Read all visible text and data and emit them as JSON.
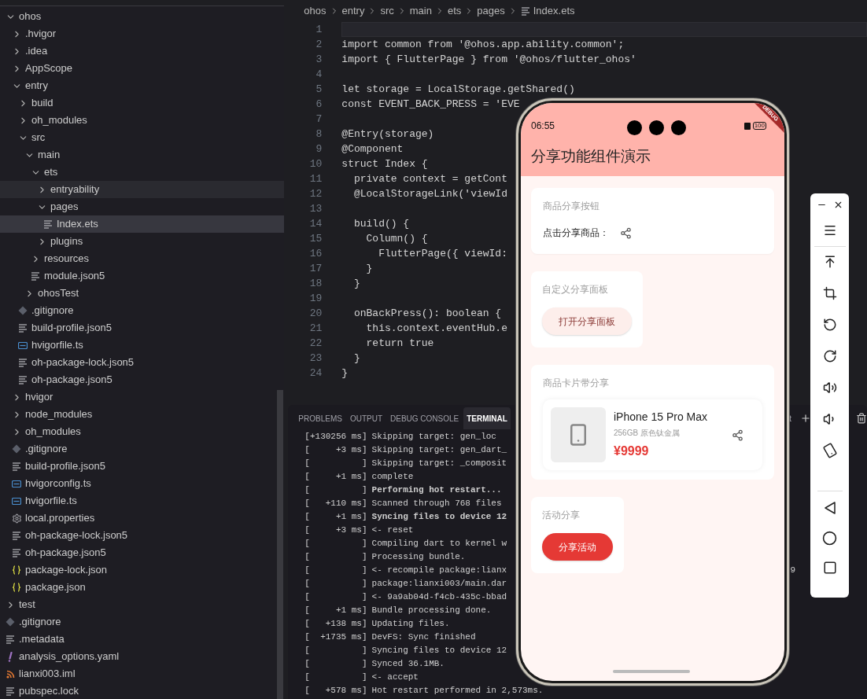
{
  "explorer": {
    "items": [
      {
        "name": "ohos",
        "kind": "folder",
        "expanded": true,
        "selected": false,
        "hovered": false,
        "children": [
          {
            "name": ".hvigor",
            "kind": "folder",
            "expanded": false,
            "selected": false,
            "hovered": false
          },
          {
            "name": ".idea",
            "kind": "folder",
            "expanded": false,
            "selected": false,
            "hovered": false
          },
          {
            "name": "AppScope",
            "kind": "folder",
            "expanded": false,
            "selected": false,
            "hovered": false
          },
          {
            "name": "entry",
            "kind": "folder",
            "expanded": true,
            "selected": false,
            "hovered": false,
            "children": [
              {
                "name": "build",
                "kind": "folder",
                "expanded": false,
                "selected": false,
                "hovered": false
              },
              {
                "name": "oh_modules",
                "kind": "folder",
                "expanded": false,
                "selected": false,
                "hovered": false
              },
              {
                "name": "src",
                "kind": "folder",
                "expanded": true,
                "selected": false,
                "hovered": false,
                "children": [
                  {
                    "name": "main",
                    "kind": "folder",
                    "expanded": true,
                    "selected": false,
                    "hovered": false,
                    "children": [
                      {
                        "name": "ets",
                        "kind": "folder",
                        "expanded": true,
                        "selected": false,
                        "hovered": false,
                        "children": [
                          {
                            "name": "entryability",
                            "kind": "folder",
                            "expanded": false,
                            "selected": false,
                            "hovered": true
                          },
                          {
                            "name": "pages",
                            "kind": "folder",
                            "expanded": true,
                            "selected": false,
                            "hovered": false,
                            "children": [
                              {
                                "name": "Index.ets",
                                "kind": "text",
                                "selected": true,
                                "hovered": false
                              }
                            ]
                          },
                          {
                            "name": "plugins",
                            "kind": "folder",
                            "expanded": false,
                            "selected": false,
                            "hovered": false
                          }
                        ]
                      },
                      {
                        "name": "resources",
                        "kind": "folder",
                        "expanded": false,
                        "selected": false,
                        "hovered": false
                      },
                      {
                        "name": "module.json5",
                        "kind": "text",
                        "selected": false,
                        "hovered": false
                      }
                    ]
                  },
                  {
                    "name": "ohosTest",
                    "kind": "folder",
                    "expanded": false,
                    "selected": false,
                    "hovered": false
                  }
                ]
              },
              {
                "name": ".gitignore",
                "kind": "git",
                "selected": false,
                "hovered": false
              },
              {
                "name": "build-profile.json5",
                "kind": "text",
                "selected": false,
                "hovered": false
              },
              {
                "name": "hvigorfile.ts",
                "kind": "ts",
                "selected": false,
                "hovered": false
              },
              {
                "name": "oh-package-lock.json5",
                "kind": "text",
                "selected": false,
                "hovered": false
              },
              {
                "name": "oh-package.json5",
                "kind": "text",
                "selected": false,
                "hovered": false
              }
            ]
          },
          {
            "name": "hvigor",
            "kind": "folder",
            "expanded": false,
            "selected": false,
            "hovered": false
          },
          {
            "name": "node_modules",
            "kind": "folder",
            "expanded": false,
            "selected": false,
            "hovered": false
          },
          {
            "name": "oh_modules",
            "kind": "folder",
            "expanded": false,
            "selected": false,
            "hovered": false
          },
          {
            "name": ".gitignore",
            "kind": "git",
            "selected": false,
            "hovered": false
          },
          {
            "name": "build-profile.json5",
            "kind": "text",
            "selected": false,
            "hovered": false
          },
          {
            "name": "hvigorconfig.ts",
            "kind": "ts",
            "selected": false,
            "hovered": false
          },
          {
            "name": "hvigorfile.ts",
            "kind": "ts",
            "selected": false,
            "hovered": false
          },
          {
            "name": "local.properties",
            "kind": "settings",
            "selected": false,
            "hovered": false
          },
          {
            "name": "oh-package-lock.json5",
            "kind": "text",
            "selected": false,
            "hovered": false
          },
          {
            "name": "oh-package.json5",
            "kind": "text",
            "selected": false,
            "hovered": false
          },
          {
            "name": "package-lock.json",
            "kind": "json",
            "selected": false,
            "hovered": false
          },
          {
            "name": "package.json",
            "kind": "json",
            "selected": false,
            "hovered": false
          }
        ]
      },
      {
        "name": "test",
        "kind": "folder",
        "expanded": false,
        "selected": false,
        "hovered": false
      },
      {
        "name": ".gitignore",
        "kind": "git",
        "selected": false,
        "hovered": false
      },
      {
        "name": ".metadata",
        "kind": "text",
        "selected": false,
        "hovered": false
      },
      {
        "name": "analysis_options.yaml",
        "kind": "yaml",
        "selected": false,
        "hovered": false
      },
      {
        "name": "lianxi003.iml",
        "kind": "xml",
        "selected": false,
        "hovered": false
      },
      {
        "name": "pubspec.lock",
        "kind": "text",
        "selected": false,
        "hovered": false
      }
    ]
  },
  "editor": {
    "breadcrumb": [
      "ohos",
      "entry",
      "src",
      "main",
      "ets",
      "pages",
      "Index.ets"
    ],
    "lines": [
      {
        "number": "1"
      },
      {
        "number": "2",
        "code": "import common from '@ohos.app.ability.common';"
      },
      {
        "number": "3",
        "code": "import { FlutterPage } from '@ohos/flutter_ohos'"
      },
      {
        "number": "4"
      },
      {
        "number": "5",
        "code": "let storage = LocalStorage.getShared()"
      },
      {
        "number": "6",
        "code": "const EVENT_BACK_PRESS = 'EVE"
      },
      {
        "number": "7"
      },
      {
        "number": "8",
        "code": "@Entry(storage)"
      },
      {
        "number": "9",
        "code": "@Component"
      },
      {
        "number": "10",
        "code": "struct Index {"
      },
      {
        "number": "11",
        "code": "  private context = getCont"
      },
      {
        "number": "12",
        "code": "  @LocalStorageLink('viewId"
      },
      {
        "number": "13"
      },
      {
        "number": "14",
        "code": "  build() {"
      },
      {
        "number": "15",
        "code": "    Column() {"
      },
      {
        "number": "16",
        "code": "      FlutterPage({ viewId:"
      },
      {
        "number": "17",
        "code": "    }"
      },
      {
        "number": "18",
        "code": "  }"
      },
      {
        "number": "19"
      },
      {
        "number": "20",
        "code": "  onBackPress(): boolean {"
      },
      {
        "number": "21",
        "code": "    this.context.eventHub.e"
      },
      {
        "number": "22",
        "code": "    return true"
      },
      {
        "number": "23",
        "code": "  }"
      },
      {
        "number": "24",
        "code": "}"
      }
    ]
  },
  "panel": {
    "tabs": [
      {
        "label": "PROBLEMS",
        "selected": false
      },
      {
        "label": "OUTPUT",
        "selected": false
      },
      {
        "label": "DEBUG CONSOLE",
        "selected": false
      },
      {
        "label": "TERMINAL",
        "selected": true
      }
    ],
    "shell_label": "t",
    "lines": [
      {
        "time": "[+130256 ms]",
        "text": "Skipping target: gen_loc",
        "bold": false
      },
      {
        "time": "[     +3 ms]",
        "text": "Skipping target: gen_dart_",
        "bold": false
      },
      {
        "time": "[          ]",
        "text": "Skipping target: _composit",
        "bold": false
      },
      {
        "time": "[     +1 ms]",
        "text": "complete",
        "bold": false
      },
      {
        "time": "[          ]",
        "text": "Performing hot restart...",
        "bold": true
      },
      {
        "time": "[   +110 ms]",
        "text": "Scanned through 768 files",
        "bold": false
      },
      {
        "time": "[     +1 ms]",
        "text": "Syncing files to device 12",
        "bold": true
      },
      {
        "time": "[     +3 ms]",
        "text": "<- reset",
        "bold": false
      },
      {
        "time": "[          ]",
        "text": "Compiling dart to kernel w",
        "bold": false
      },
      {
        "time": "[          ]",
        "text": "Processing bundle.",
        "bold": false
      },
      {
        "time": "[          ]",
        "text": "<- recompile package:lianx",
        "bold": false,
        "tail": "9"
      },
      {
        "time": "[          ]",
        "text": "package:lianxi003/main.dar",
        "bold": false
      },
      {
        "time": "[          ]",
        "text": "<- 9a9ab04d-f4cb-435c-bbad",
        "bold": false
      },
      {
        "time": "[     +1 ms]",
        "text": "Bundle processing done.",
        "bold": false
      },
      {
        "time": "[   +138 ms]",
        "text": "Updating files.",
        "bold": false
      },
      {
        "time": "[  +1735 ms]",
        "text": "DevFS: Sync finished",
        "bold": false
      },
      {
        "time": "[          ]",
        "text": "Syncing files to device 12",
        "bold": false
      },
      {
        "time": "[          ]",
        "text": "Synced 36.1MB.",
        "bold": false
      },
      {
        "time": "[          ]",
        "text": "<- accept",
        "bold": false
      },
      {
        "time": "[   +578 ms]",
        "text": "Hot restart performed in 2,573ms.",
        "bold": false
      }
    ]
  },
  "phone": {
    "status_bar": {
      "time": "06:55",
      "battery": "100"
    },
    "debug_banner": "DEBUG",
    "app_bar": {
      "title": "分享功能组件演示"
    },
    "cards": [
      {
        "kind": "share_row",
        "title": "商品分享按钮",
        "label": "点击分享商品："
      },
      {
        "kind": "tonal_button",
        "title": "自定义分享面板",
        "button": "打开分享面板"
      },
      {
        "kind": "product",
        "title": "商品卡片带分享",
        "product": {
          "name": "iPhone 15 Pro Max",
          "spec": "256GB 原色钛金属",
          "price": "¥9999"
        }
      },
      {
        "kind": "filled_button",
        "title": "活动分享",
        "button": "分享活动"
      }
    ]
  }
}
